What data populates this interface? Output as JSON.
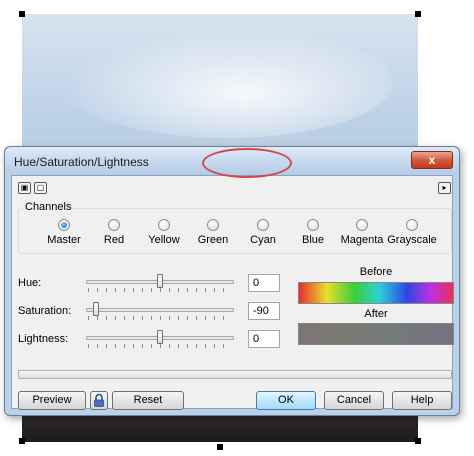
{
  "dialog": {
    "title": "Hue/Saturation/Lightness",
    "close_label": "x"
  },
  "toolbar": {
    "left_icons": [
      "view-toggle-icon",
      "preview-window-icon"
    ],
    "right_icon": "play-arrow-icon"
  },
  "channels": {
    "group_label": "Channels",
    "selected": "Master",
    "items": [
      {
        "label": "Master",
        "checked": true
      },
      {
        "label": "Red",
        "checked": false
      },
      {
        "label": "Yellow",
        "checked": false
      },
      {
        "label": "Green",
        "checked": false
      },
      {
        "label": "Cyan",
        "checked": false
      },
      {
        "label": "Blue",
        "checked": false
      },
      {
        "label": "Magenta",
        "checked": false
      },
      {
        "label": "Grayscale",
        "checked": false
      }
    ]
  },
  "adjustments": {
    "hue": {
      "label": "Hue:",
      "value": "0",
      "min": -180,
      "max": 180
    },
    "saturation": {
      "label": "Saturation:",
      "value": "-90",
      "min": -100,
      "max": 100
    },
    "lightness": {
      "label": "Lightness:",
      "value": "0",
      "min": -100,
      "max": 100
    }
  },
  "preview": {
    "before_label": "Before",
    "after_label": "After"
  },
  "buttons": {
    "preview": "Preview",
    "lock_icon": "lock-icon",
    "reset": "Reset",
    "ok": "OK",
    "cancel": "Cancel",
    "help": "Help"
  },
  "colors": {
    "dialog_frame": "#b9d1ea",
    "highlight_ellipse": "#d0484b"
  }
}
